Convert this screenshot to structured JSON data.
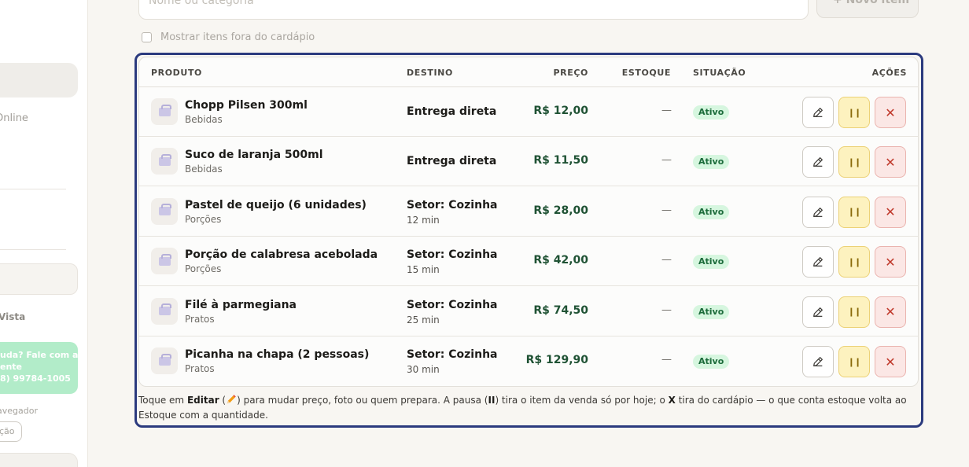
{
  "sidebar": {
    "online_label": "Online",
    "vista_label": "Vista",
    "help_lines": [
      "uda? Fale com a",
      "ente",
      "8) 99784-1005"
    ],
    "navigator_label": "avegador",
    "navigator_button": "ção"
  },
  "toolbar": {
    "search_placeholder": "Nome ou categoria",
    "new_item_label": "+ Novo item"
  },
  "filters": {
    "show_off_menu_label": "Mostrar itens fora do cardápio"
  },
  "table": {
    "headers": {
      "product": "PRODUTO",
      "destination": "DESTINO",
      "price": "PREÇO",
      "stock": "ESTOQUE",
      "status": "SITUAÇÃO",
      "actions": "AÇÕES"
    },
    "rows": [
      {
        "name": "Chopp Pilsen 300ml",
        "category": "Bebidas",
        "destination": "Entrega direta",
        "destination_time": "",
        "price": "R$ 12,00",
        "stock": "—",
        "status": "Ativo"
      },
      {
        "name": "Suco de laranja 500ml",
        "category": "Bebidas",
        "destination": "Entrega direta",
        "destination_time": "",
        "price": "R$ 11,50",
        "stock": "—",
        "status": "Ativo"
      },
      {
        "name": "Pastel de queijo (6 unidades)",
        "category": "Porções",
        "destination": "Setor: Cozinha",
        "destination_time": "12 min",
        "price": "R$ 28,00",
        "stock": "—",
        "status": "Ativo"
      },
      {
        "name": "Porção de calabresa acebolada",
        "category": "Porções",
        "destination": "Setor: Cozinha",
        "destination_time": "15 min",
        "price": "R$ 42,00",
        "stock": "—",
        "status": "Ativo"
      },
      {
        "name": "Filé à parmegiana",
        "category": "Pratos",
        "destination": "Setor: Cozinha",
        "destination_time": "25 min",
        "price": "R$ 74,50",
        "stock": "—",
        "status": "Ativo"
      },
      {
        "name": "Picanha na chapa (2 pessoas)",
        "category": "Pratos",
        "destination": "Setor: Cozinha",
        "destination_time": "30 min",
        "price": "R$ 129,90",
        "stock": "—",
        "status": "Ativo"
      }
    ]
  },
  "footnote": {
    "part1": "Toque em ",
    "edit_word": "Editar",
    "part2": " (",
    "part3": ") para mudar preço, foto ou quem prepara. A pausa (",
    "pause_symbol": "II",
    "part4": ") tira o item da venda só por hoje; o ",
    "x_word": "X",
    "part5": " tira do cardápio — o que conta estoque volta ao Estoque com a quantidade."
  },
  "colors": {
    "highlight_border": "#2b3a7e",
    "price_green": "#1f5234",
    "status_badge_bg": "#d6f6df",
    "pause_bg": "#fdf2bf",
    "delete_bg": "#fbe7e5"
  },
  "icons": {
    "edit": "pencil-icon",
    "pause": "pause-icon",
    "delete": "close-icon",
    "thumbnail": "food-bowl-icon"
  }
}
